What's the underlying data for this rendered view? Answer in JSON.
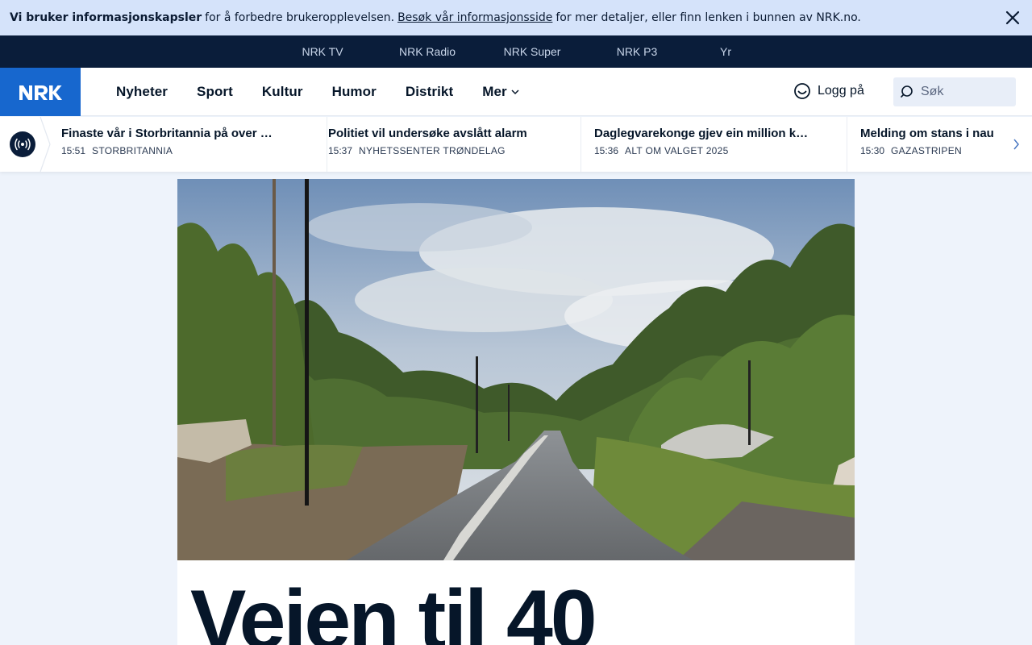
{
  "cookie_banner": {
    "strong_text": "Vi bruker informasjonskapsler",
    "text1": "for å forbedre brukeropplevelsen.",
    "link_text": "Besøk vår informasjonsside",
    "text2": "for mer detaljer, eller finn lenken i bunnen av NRK.no."
  },
  "service_nav": [
    "NRK TV",
    "NRK Radio",
    "NRK Super",
    "NRK P3",
    "Yr"
  ],
  "main_nav": {
    "logo": "NRK",
    "items": [
      "Nyheter",
      "Sport",
      "Kultur",
      "Humor",
      "Distrikt",
      "Mer"
    ],
    "login_label": "Logg på",
    "search_placeholder": "Søk"
  },
  "ticker": [
    {
      "title": "Finaste vår i Storbritannia på over …",
      "time": "15:51",
      "category": "Storbritannia"
    },
    {
      "title": "Politiet vil undersøke avslått alarm",
      "time": "15:37",
      "category": "Nyhetssenter Trøndelag"
    },
    {
      "title": "Daglegvarekonge gjev ein million k…",
      "time": "15:36",
      "category": "Alt om valget 2025"
    },
    {
      "title": "Melding om stans i nau",
      "time": "15:30",
      "category": "Gazastripen"
    }
  ],
  "article": {
    "headline": "Veien til 40"
  },
  "colors": {
    "brand_blue": "#1767ce",
    "dark_navy": "#0a1d3a",
    "banner_bg": "#d5e3fa",
    "page_bg": "#eef3fb"
  }
}
